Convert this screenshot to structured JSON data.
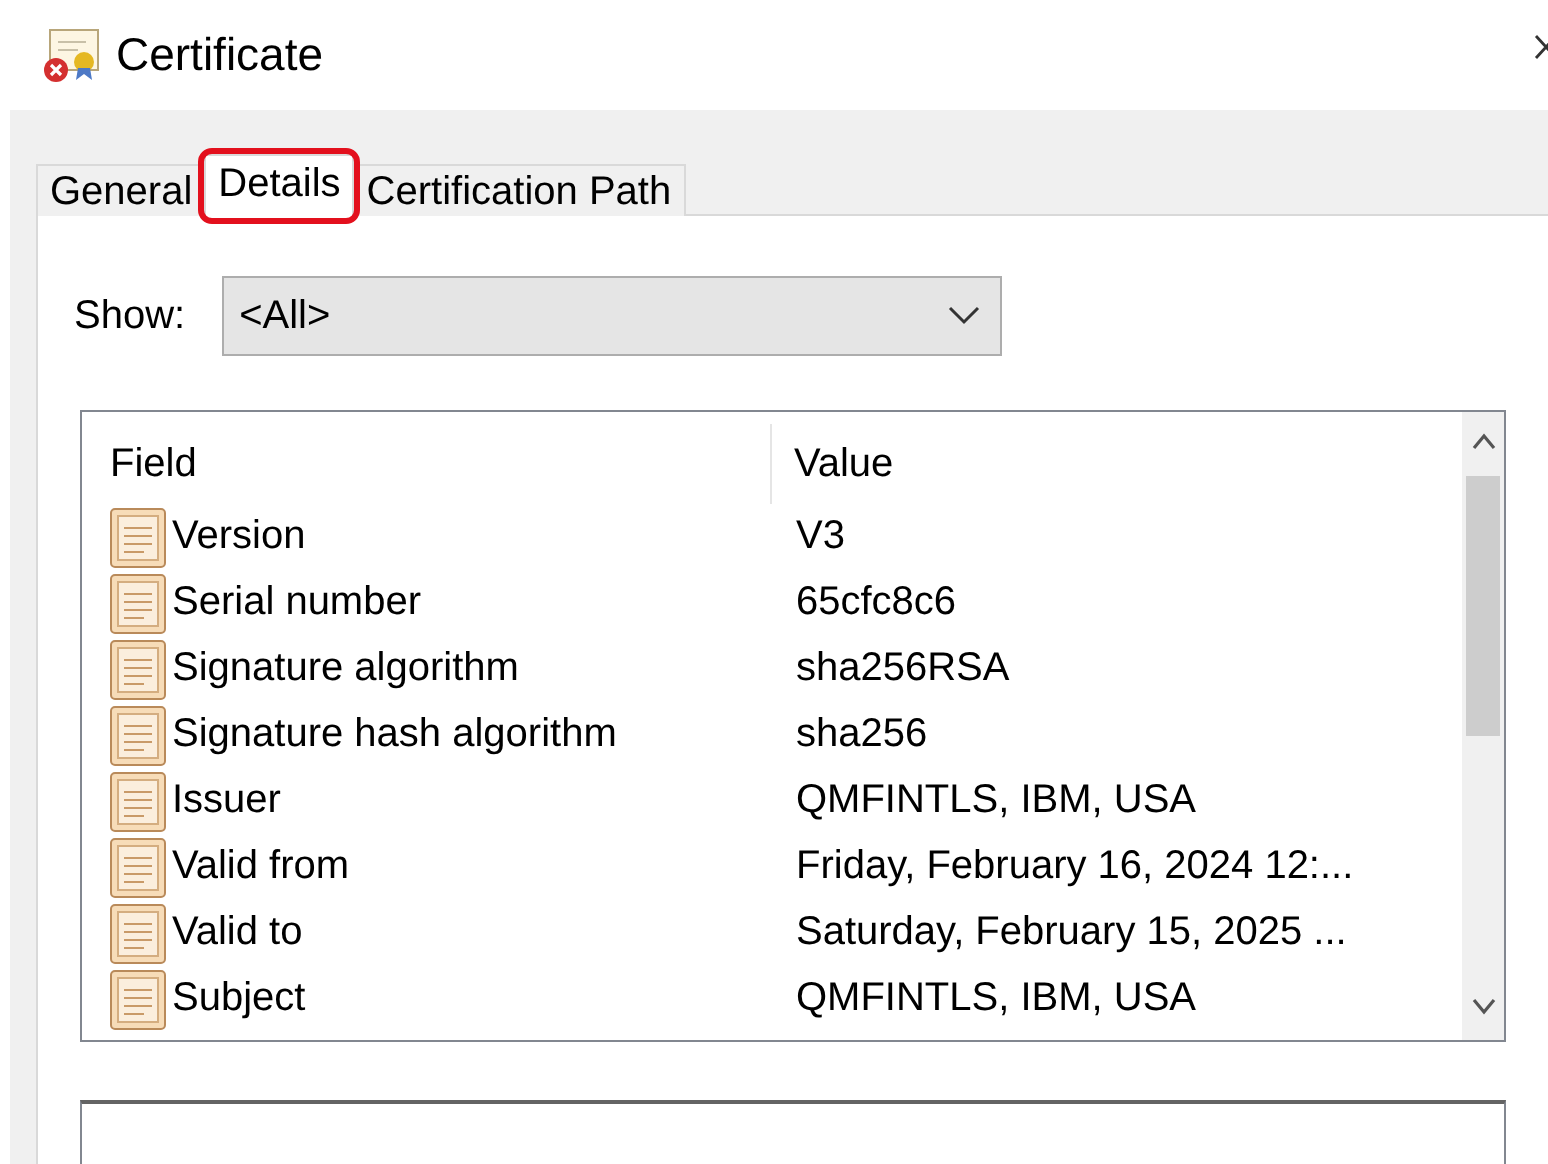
{
  "window": {
    "title": "Certificate"
  },
  "tabs": [
    {
      "label": "General",
      "selected": false,
      "highlighted": false
    },
    {
      "label": "Details",
      "selected": true,
      "highlighted": true
    },
    {
      "label": "Certification Path",
      "selected": false,
      "highlighted": false
    }
  ],
  "show": {
    "label": "Show:",
    "value": "<All>"
  },
  "table": {
    "columns": [
      "Field",
      "Value"
    ],
    "rows": [
      {
        "field": "Version",
        "value": "V3"
      },
      {
        "field": "Serial number",
        "value": "65cfc8c6"
      },
      {
        "field": "Signature algorithm",
        "value": "sha256RSA"
      },
      {
        "field": "Signature hash algorithm",
        "value": "sha256"
      },
      {
        "field": "Issuer",
        "value": "QMFINTLS, IBM, USA"
      },
      {
        "field": "Valid from",
        "value": "Friday, February 16, 2024 12:..."
      },
      {
        "field": "Valid to",
        "value": "Saturday, February 15, 2025 ..."
      },
      {
        "field": "Subject",
        "value": "QMFINTLS, IBM, USA"
      }
    ]
  }
}
